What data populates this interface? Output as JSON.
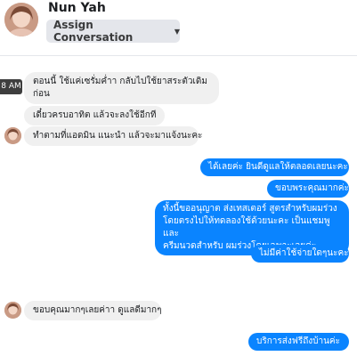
{
  "header": {
    "contact_name": "Nun Yah",
    "assign_label": "Assign Conversation",
    "assign_icon": "caret-down-icon"
  },
  "timestamp_tooltip": "8 AM",
  "messages": [
    {
      "side": "in",
      "text": "ตอนนี้ ใช้แค่เซรั่มค่ำา กลับไปใช้ยาสระตัวเดิม\nก่อน"
    },
    {
      "side": "in",
      "text": "เดี๋ยวครบอาทิต แล้วจะลงใช้อีกที"
    },
    {
      "side": "in",
      "text": "ทำตามที่แอดมิน แนะนำ แล้วจะมาแจ้งนะคะ"
    },
    {
      "side": "out",
      "text": "ได้เลยค่ะ ยินดีดูแลให้ตลอดเลยนะคะ"
    },
    {
      "side": "out",
      "text": "ขอบพระคุณมากค่ะ"
    },
    {
      "side": "out",
      "text": "ทั้งนี้ขออนุญาต ส่งเทสเตอร์ สูตรสำหรับผมร่วง\nโดยตรงไปให้ทดลองใช้ด้วยนะคะ เป็นแชมพูและ\nครีมนวดสำหรับ ผมร่วงโดยเฉพาะเลยค่ะ"
    },
    {
      "side": "out",
      "text": "ไม่มีค่าใช้จ่ายใดๆนะคะ"
    },
    {
      "side": "in",
      "text": "ขอบคุณมากๆเลยค่าา ดูแลดีมากๆ"
    },
    {
      "side": "out",
      "text": "บริการส่งฟรีถึงบ้านค่ะ"
    }
  ],
  "colors": {
    "outgoing_bubble": "#0a84ff",
    "incoming_bubble": "#f0f0f0"
  }
}
